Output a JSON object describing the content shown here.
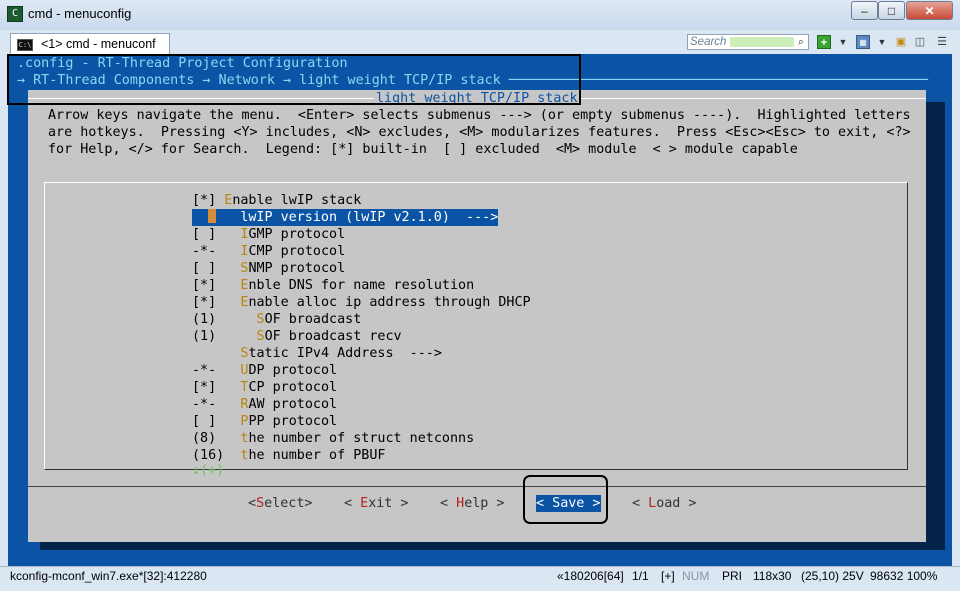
{
  "window": {
    "title": "cmd - menuconfig",
    "min": "–",
    "max": "□",
    "close": "✕"
  },
  "tabbar": {
    "tab_label": "<1> cmd - menuconf",
    "search_placeholder": "Search"
  },
  "header": {
    "line1": ".config - RT-Thread Project Configuration",
    "line2": "→ RT-Thread Components → Network → light weight TCP/IP stack ────────────────────────────────────────────────────"
  },
  "dialog": {
    "title": "light weight TCP/IP stack",
    "help": [
      "Arrow keys navigate the menu.  <Enter> selects submenus ---> (or empty submenus ----).  Highlighted letters",
      "are hotkeys.  Pressing <Y> includes, <N> excludes, <M> modularizes features.  Press <Esc><Esc> to exit, <?>",
      "for Help, </> for Search.  Legend: [*] built-in  [ ] excluded  <M> module  < > module capable"
    ],
    "items": [
      {
        "prefix": "[*] ",
        "hotkey": "E",
        "rest": "nable lwIP stack"
      },
      {
        "prefix": "      ",
        "hotkey": "l",
        "rest": "wIP version (lwIP v2.1.0)  --->"
      },
      {
        "prefix": "[ ]   ",
        "hotkey": "I",
        "rest": "GMP protocol"
      },
      {
        "prefix": "-*-   ",
        "hotkey": "I",
        "rest": "CMP protocol"
      },
      {
        "prefix": "[ ]   ",
        "hotkey": "S",
        "rest": "NMP protocol"
      },
      {
        "prefix": "[*]   ",
        "hotkey": "E",
        "rest": "nble DNS for name resolution"
      },
      {
        "prefix": "[*]   ",
        "hotkey": "E",
        "rest": "nable alloc ip address through DHCP"
      },
      {
        "prefix": "(1)     ",
        "hotkey": "S",
        "rest": "OF broadcast"
      },
      {
        "prefix": "(1)     ",
        "hotkey": "S",
        "rest": "OF broadcast recv"
      },
      {
        "prefix": "      ",
        "hotkey": "S",
        "rest": "tatic IPv4 Address  --->"
      },
      {
        "prefix": "-*-   ",
        "hotkey": "U",
        "rest": "DP protocol"
      },
      {
        "prefix": "[*]   ",
        "hotkey": "T",
        "rest": "CP protocol"
      },
      {
        "prefix": "-*-   ",
        "hotkey": "R",
        "rest": "AW protocol"
      },
      {
        "prefix": "[ ]   ",
        "hotkey": "P",
        "rest": "PP protocol"
      },
      {
        "prefix": "(8)   ",
        "hotkey": "t",
        "rest": "he number of struct netconns"
      },
      {
        "prefix": "(16)  ",
        "hotkey": "t",
        "rest": "he number of PBUF"
      }
    ],
    "more": "↓(+)",
    "buttons": {
      "select": {
        "l": "<",
        "k": "S",
        "r": "elect>"
      },
      "exit": {
        "l": "< ",
        "k": "E",
        "r": "xit >"
      },
      "help": {
        "l": "< ",
        "k": "H",
        "r": "elp >"
      },
      "save": {
        "l": "< ",
        "k": "S",
        "r": "ave >"
      },
      "load": {
        "l": "< ",
        "k": "L",
        "r": "oad >"
      }
    }
  },
  "statusbar": {
    "left": "kconfig-mconf_win7.exe*[32]:412280",
    "pos": "«180206[64]",
    "page": "1/1",
    "plus": "[+]",
    "num": "NUM",
    "pri": "PRI",
    "size": "118x30",
    "cursor": "(25,10) 25V",
    "mem": "98632 100%"
  },
  "colors": {
    "console_bg": "#0b54a5",
    "dialog_bg": "#c6c6c6",
    "selection": "#0b54a5",
    "hotkey": "#b8860b",
    "header_text": "#8ad7f2"
  },
  "icons": {
    "app": "console-app-icon",
    "tab": "console-tab-icon",
    "search": "search-icon",
    "add": "plus-icon",
    "view": "view-icon",
    "lock": "lock-icon",
    "panels": "panels-icon",
    "menu": "hamburger-icon"
  }
}
